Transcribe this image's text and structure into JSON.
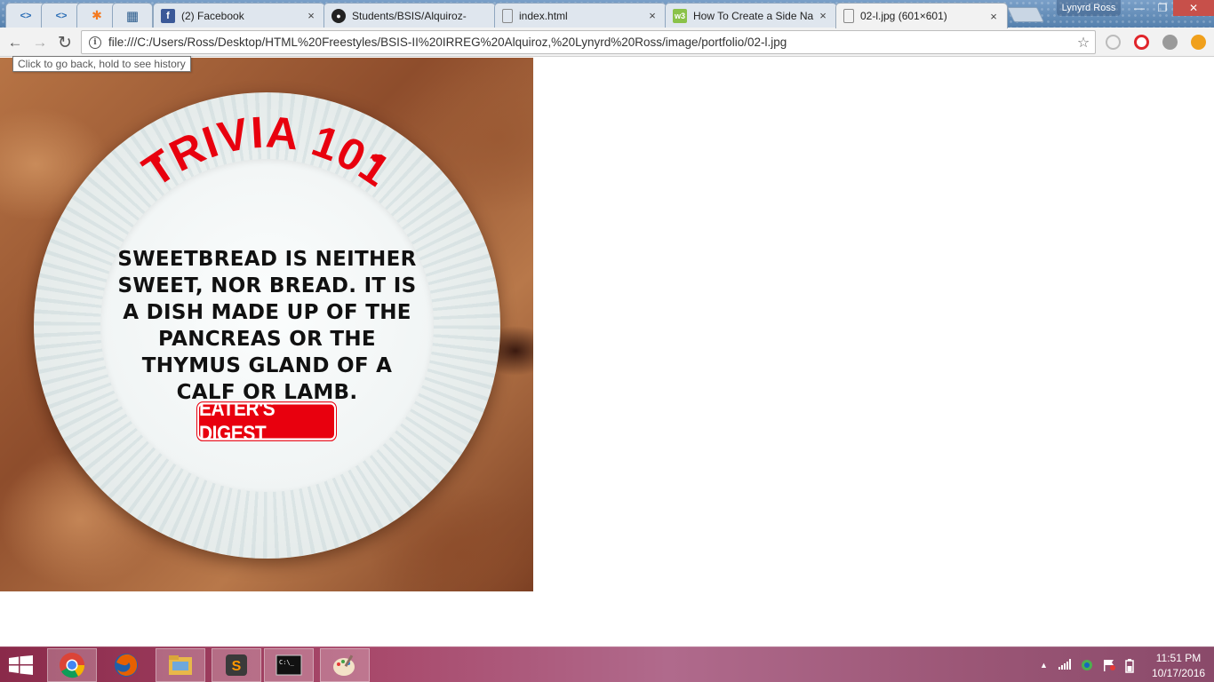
{
  "browser": {
    "tabs": [
      {
        "title": "",
        "icon": "code-brackets-icon"
      },
      {
        "title": "",
        "icon": "code-brackets-icon"
      },
      {
        "title": "",
        "icon": "avast-icon"
      },
      {
        "title": "",
        "icon": "grid-icon"
      },
      {
        "title": "(2) Facebook",
        "icon": "facebook-icon"
      },
      {
        "title": "Students/BSIS/Alquiroz-",
        "icon": "github-icon"
      },
      {
        "title": "index.html",
        "icon": "file-icon"
      },
      {
        "title": "How To Create a Side Na",
        "icon": "w3schools-icon"
      },
      {
        "title": "02-l.jpg (601×601)",
        "icon": "file-icon"
      }
    ],
    "close_glyph": "×",
    "profile_name": "Lynyrd Ross",
    "window_controls": {
      "minimize": "—",
      "restore": "❐",
      "close": "✕"
    },
    "url": "file:///C:/Users/Ross/Desktop/HTML%20Freestyles/BSIS-II%20IRREG%20Alquiroz,%20Lynyrd%20Ross/image/portfolio/02-l.jpg",
    "info_glyph": "i",
    "back_glyph": "←",
    "forward_glyph": "→",
    "reload_glyph": "↻",
    "star_glyph": "☆",
    "tooltip": "Click to go back, hold to see history"
  },
  "image": {
    "heading": "TRIVIA 101",
    "fact": "SWEETBREAD IS NEITHER SWEET, NOR BREAD. IT IS A DISH MADE UP OF THE PANCREAS OR THE THYMUS GLAND OF A CALF OR LAMB.",
    "brand": "EATER'S DIGEST",
    "accent_color": "#e8000e"
  },
  "taskbar": {
    "apps": [
      "chrome",
      "firefox",
      "file-explorer",
      "sublime-text",
      "command-prompt",
      "paint"
    ],
    "time": "11:51 PM",
    "date": "10/17/2016",
    "tray_up_glyph": "▲"
  }
}
